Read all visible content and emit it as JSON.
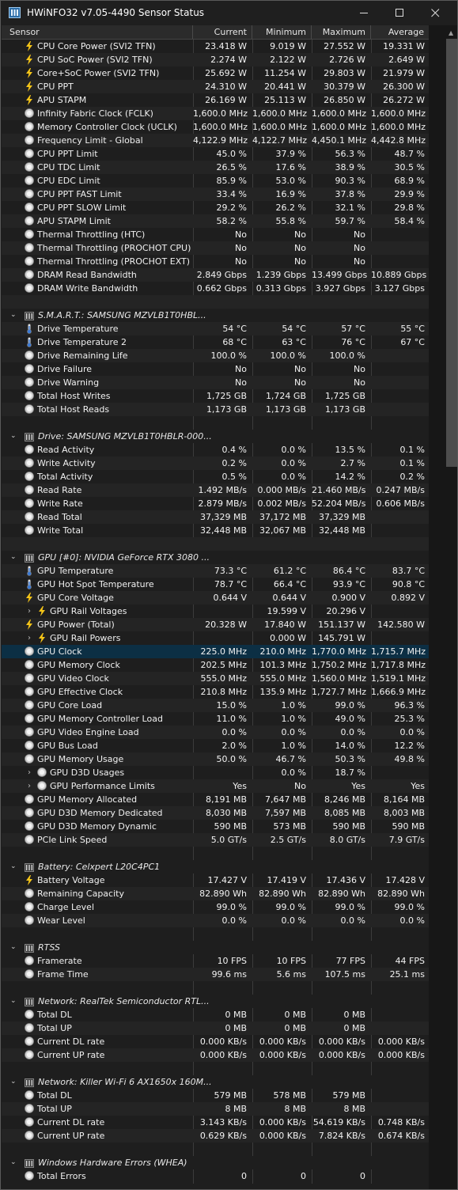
{
  "window": {
    "title": "HWiNFO32 v7.05-4490 Sensor Status"
  },
  "header": {
    "sensor": "Sensor",
    "current": "Current",
    "minimum": "Minimum",
    "maximum": "Maximum",
    "average": "Average"
  },
  "rows": [
    {
      "kind": "row",
      "icon": "bolt-icon",
      "label": "CPU Core Power (SVI2 TFN)",
      "cur": "23.418 W",
      "min": "9.019 W",
      "max": "27.552 W",
      "avg": "19.331 W"
    },
    {
      "kind": "row",
      "icon": "bolt-icon",
      "label": "CPU SoC Power (SVI2 TFN)",
      "cur": "2.274 W",
      "min": "2.122 W",
      "max": "2.726 W",
      "avg": "2.649 W"
    },
    {
      "kind": "row",
      "icon": "bolt-icon",
      "label": "Core+SoC Power (SVI2 TFN)",
      "cur": "25.692 W",
      "min": "11.254 W",
      "max": "29.803 W",
      "avg": "21.979 W"
    },
    {
      "kind": "row",
      "icon": "bolt-icon",
      "label": "CPU PPT",
      "cur": "24.310 W",
      "min": "20.441 W",
      "max": "30.379 W",
      "avg": "26.300 W"
    },
    {
      "kind": "row",
      "icon": "bolt-icon",
      "label": "APU STAPM",
      "cur": "26.169 W",
      "min": "25.113 W",
      "max": "26.850 W",
      "avg": "26.272 W"
    },
    {
      "kind": "row",
      "icon": "gauge-icon",
      "label": "Infinity Fabric Clock (FCLK)",
      "cur": "1,600.0 MHz",
      "min": "1,600.0 MHz",
      "max": "1,600.0 MHz",
      "avg": "1,600.0 MHz"
    },
    {
      "kind": "row",
      "icon": "gauge-icon",
      "label": "Memory Controller Clock (UCLK)",
      "cur": "1,600.0 MHz",
      "min": "1,600.0 MHz",
      "max": "1,600.0 MHz",
      "avg": "1,600.0 MHz"
    },
    {
      "kind": "row",
      "icon": "gauge-icon",
      "label": "Frequency Limit - Global",
      "cur": "4,122.9 MHz",
      "min": "4,122.7 MHz",
      "max": "4,450.1 MHz",
      "avg": "4,442.8 MHz"
    },
    {
      "kind": "row",
      "icon": "gauge-icon",
      "label": "CPU PPT Limit",
      "cur": "45.0 %",
      "min": "37.9 %",
      "max": "56.3 %",
      "avg": "48.7 %"
    },
    {
      "kind": "row",
      "icon": "gauge-icon",
      "label": "CPU TDC Limit",
      "cur": "26.5 %",
      "min": "17.6 %",
      "max": "38.9 %",
      "avg": "30.5 %"
    },
    {
      "kind": "row",
      "icon": "gauge-icon",
      "label": "CPU EDC Limit",
      "cur": "85.9 %",
      "min": "53.0 %",
      "max": "90.3 %",
      "avg": "68.9 %"
    },
    {
      "kind": "row",
      "icon": "gauge-icon",
      "label": "CPU PPT FAST Limit",
      "cur": "33.4 %",
      "min": "16.9 %",
      "max": "37.8 %",
      "avg": "29.9 %"
    },
    {
      "kind": "row",
      "icon": "gauge-icon",
      "label": "CPU PPT SLOW Limit",
      "cur": "29.2 %",
      "min": "26.2 %",
      "max": "32.1 %",
      "avg": "29.8 %"
    },
    {
      "kind": "row",
      "icon": "gauge-icon",
      "label": "APU STAPM Limit",
      "cur": "58.2 %",
      "min": "55.8 %",
      "max": "59.7 %",
      "avg": "58.4 %"
    },
    {
      "kind": "row",
      "icon": "gauge-icon",
      "label": "Thermal Throttling (HTC)",
      "cur": "No",
      "min": "No",
      "max": "No",
      "avg": ""
    },
    {
      "kind": "row",
      "icon": "gauge-icon",
      "label": "Thermal Throttling (PROCHOT CPU)",
      "cur": "No",
      "min": "No",
      "max": "No",
      "avg": ""
    },
    {
      "kind": "row",
      "icon": "gauge-icon",
      "label": "Thermal Throttling (PROCHOT EXT)",
      "cur": "No",
      "min": "No",
      "max": "No",
      "avg": ""
    },
    {
      "kind": "row",
      "icon": "gauge-icon",
      "label": "DRAM Read Bandwidth",
      "cur": "2.849 Gbps",
      "min": "1.239 Gbps",
      "max": "13.499 Gbps",
      "avg": "10.889 Gbps"
    },
    {
      "kind": "row",
      "icon": "gauge-icon",
      "label": "DRAM Write Bandwidth",
      "cur": "0.662 Gbps",
      "min": "0.313 Gbps",
      "max": "3.927 Gbps",
      "avg": "3.127 Gbps"
    },
    {
      "kind": "blank"
    },
    {
      "kind": "group",
      "label": "S.M.A.R.T.: SAMSUNG MZVLB1T0HBL..."
    },
    {
      "kind": "row",
      "icon": "thermometer-icon",
      "label": "Drive Temperature",
      "cur": "54 °C",
      "min": "54 °C",
      "max": "57 °C",
      "avg": "55 °C"
    },
    {
      "kind": "row",
      "icon": "thermometer-icon",
      "label": "Drive Temperature 2",
      "cur": "68 °C",
      "min": "63 °C",
      "max": "76 °C",
      "avg": "67 °C"
    },
    {
      "kind": "row",
      "icon": "gauge-icon",
      "label": "Drive Remaining Life",
      "cur": "100.0 %",
      "min": "100.0 %",
      "max": "100.0 %",
      "avg": ""
    },
    {
      "kind": "row",
      "icon": "gauge-icon",
      "label": "Drive Failure",
      "cur": "No",
      "min": "No",
      "max": "No",
      "avg": ""
    },
    {
      "kind": "row",
      "icon": "gauge-icon",
      "label": "Drive Warning",
      "cur": "No",
      "min": "No",
      "max": "No",
      "avg": ""
    },
    {
      "kind": "row",
      "icon": "gauge-icon",
      "label": "Total Host Writes",
      "cur": "1,725 GB",
      "min": "1,724 GB",
      "max": "1,725 GB",
      "avg": ""
    },
    {
      "kind": "row",
      "icon": "gauge-icon",
      "label": "Total Host Reads",
      "cur": "1,173 GB",
      "min": "1,173 GB",
      "max": "1,173 GB",
      "avg": ""
    },
    {
      "kind": "blank"
    },
    {
      "kind": "group",
      "label": "Drive: SAMSUNG MZVLB1T0HBLR-000..."
    },
    {
      "kind": "row",
      "icon": "gauge-icon",
      "label": "Read Activity",
      "cur": "0.4 %",
      "min": "0.0 %",
      "max": "13.5 %",
      "avg": "0.1 %"
    },
    {
      "kind": "row",
      "icon": "gauge-icon",
      "label": "Write Activity",
      "cur": "0.2 %",
      "min": "0.0 %",
      "max": "2.7 %",
      "avg": "0.1 %"
    },
    {
      "kind": "row",
      "icon": "gauge-icon",
      "label": "Total Activity",
      "cur": "0.5 %",
      "min": "0.0 %",
      "max": "14.2 %",
      "avg": "0.2 %"
    },
    {
      "kind": "row",
      "icon": "gauge-icon",
      "label": "Read Rate",
      "cur": "1.492 MB/s",
      "min": "0.000 MB/s",
      "max": "21.460 MB/s",
      "avg": "0.247 MB/s"
    },
    {
      "kind": "row",
      "icon": "gauge-icon",
      "label": "Write Rate",
      "cur": "2.879 MB/s",
      "min": "0.002 MB/s",
      "max": "52.204 MB/s",
      "avg": "0.606 MB/s"
    },
    {
      "kind": "row",
      "icon": "gauge-icon",
      "label": "Read Total",
      "cur": "37,329 MB",
      "min": "37,172 MB",
      "max": "37,329 MB",
      "avg": ""
    },
    {
      "kind": "row",
      "icon": "gauge-icon",
      "label": "Write Total",
      "cur": "32,448 MB",
      "min": "32,067 MB",
      "max": "32,448 MB",
      "avg": ""
    },
    {
      "kind": "blank"
    },
    {
      "kind": "group",
      "label": "GPU [#0]: NVIDIA GeForce RTX 3080 ..."
    },
    {
      "kind": "row",
      "icon": "thermometer-icon",
      "label": "GPU Temperature",
      "cur": "73.3 °C",
      "min": "61.2 °C",
      "max": "86.4 °C",
      "avg": "83.7 °C"
    },
    {
      "kind": "row",
      "icon": "thermometer-icon",
      "label": "GPU Hot Spot Temperature",
      "cur": "78.7 °C",
      "min": "66.4 °C",
      "max": "93.9 °C",
      "avg": "90.8 °C"
    },
    {
      "kind": "row",
      "icon": "bolt-icon",
      "label": "GPU Core Voltage",
      "cur": "0.644 V",
      "min": "0.644 V",
      "max": "0.900 V",
      "avg": "0.892 V"
    },
    {
      "kind": "sub",
      "icon": "bolt-icon",
      "label": "GPU Rail Voltages",
      "cur": "",
      "min": "19.599 V",
      "max": "20.296 V",
      "avg": ""
    },
    {
      "kind": "row",
      "icon": "bolt-icon",
      "label": "GPU Power (Total)",
      "cur": "20.328 W",
      "min": "17.840 W",
      "max": "151.137 W",
      "avg": "142.580 W"
    },
    {
      "kind": "sub",
      "icon": "bolt-icon",
      "label": "GPU Rail Powers",
      "cur": "",
      "min": "0.000 W",
      "max": "145.791 W",
      "avg": ""
    },
    {
      "kind": "row",
      "icon": "gauge-icon",
      "label": "GPU Clock",
      "cur": "225.0 MHz",
      "min": "210.0 MHz",
      "max": "1,770.0 MHz",
      "avg": "1,715.7 MHz",
      "selected": true
    },
    {
      "kind": "row",
      "icon": "gauge-icon",
      "label": "GPU Memory Clock",
      "cur": "202.5 MHz",
      "min": "101.3 MHz",
      "max": "1,750.2 MHz",
      "avg": "1,717.8 MHz"
    },
    {
      "kind": "row",
      "icon": "gauge-icon",
      "label": "GPU Video Clock",
      "cur": "555.0 MHz",
      "min": "555.0 MHz",
      "max": "1,560.0 MHz",
      "avg": "1,519.1 MHz"
    },
    {
      "kind": "row",
      "icon": "gauge-icon",
      "label": "GPU Effective Clock",
      "cur": "210.8 MHz",
      "min": "135.9 MHz",
      "max": "1,727.7 MHz",
      "avg": "1,666.9 MHz"
    },
    {
      "kind": "row",
      "icon": "gauge-icon",
      "label": "GPU Core Load",
      "cur": "15.0 %",
      "min": "1.0 %",
      "max": "99.0 %",
      "avg": "96.3 %"
    },
    {
      "kind": "row",
      "icon": "gauge-icon",
      "label": "GPU Memory Controller Load",
      "cur": "11.0 %",
      "min": "1.0 %",
      "max": "49.0 %",
      "avg": "25.3 %"
    },
    {
      "kind": "row",
      "icon": "gauge-icon",
      "label": "GPU Video Engine Load",
      "cur": "0.0 %",
      "min": "0.0 %",
      "max": "0.0 %",
      "avg": "0.0 %"
    },
    {
      "kind": "row",
      "icon": "gauge-icon",
      "label": "GPU Bus Load",
      "cur": "2.0 %",
      "min": "1.0 %",
      "max": "14.0 %",
      "avg": "12.2 %"
    },
    {
      "kind": "row",
      "icon": "gauge-icon",
      "label": "GPU Memory Usage",
      "cur": "50.0 %",
      "min": "46.7 %",
      "max": "50.3 %",
      "avg": "49.8 %"
    },
    {
      "kind": "sub",
      "icon": "gauge-icon",
      "label": "GPU D3D Usages",
      "cur": "",
      "min": "0.0 %",
      "max": "18.7 %",
      "avg": ""
    },
    {
      "kind": "sub",
      "icon": "gauge-icon",
      "label": "GPU Performance Limits",
      "cur": "Yes",
      "min": "No",
      "max": "Yes",
      "avg": "Yes"
    },
    {
      "kind": "row",
      "icon": "gauge-icon",
      "label": "GPU Memory Allocated",
      "cur": "8,191 MB",
      "min": "7,647 MB",
      "max": "8,246 MB",
      "avg": "8,164 MB"
    },
    {
      "kind": "row",
      "icon": "gauge-icon",
      "label": "GPU D3D Memory Dedicated",
      "cur": "8,030 MB",
      "min": "7,597 MB",
      "max": "8,085 MB",
      "avg": "8,003 MB"
    },
    {
      "kind": "row",
      "icon": "gauge-icon",
      "label": "GPU D3D Memory Dynamic",
      "cur": "590 MB",
      "min": "573 MB",
      "max": "590 MB",
      "avg": "590 MB"
    },
    {
      "kind": "row",
      "icon": "gauge-icon",
      "label": "PCIe Link Speed",
      "cur": "5.0 GT/s",
      "min": "2.5 GT/s",
      "max": "8.0 GT/s",
      "avg": "7.9 GT/s"
    },
    {
      "kind": "blank"
    },
    {
      "kind": "group",
      "label": "Battery: Celxpert L20C4PC1"
    },
    {
      "kind": "row",
      "icon": "bolt-icon",
      "label": "Battery Voltage",
      "cur": "17.427 V",
      "min": "17.419 V",
      "max": "17.436 V",
      "avg": "17.428 V"
    },
    {
      "kind": "row",
      "icon": "gauge-icon",
      "label": "Remaining Capacity",
      "cur": "82.890 Wh",
      "min": "82.890 Wh",
      "max": "82.890 Wh",
      "avg": "82.890 Wh"
    },
    {
      "kind": "row",
      "icon": "gauge-icon",
      "label": "Charge Level",
      "cur": "99.0 %",
      "min": "99.0 %",
      "max": "99.0 %",
      "avg": "99.0 %"
    },
    {
      "kind": "row",
      "icon": "gauge-icon",
      "label": "Wear Level",
      "cur": "0.0 %",
      "min": "0.0 %",
      "max": "0.0 %",
      "avg": "0.0 %"
    },
    {
      "kind": "blank"
    },
    {
      "kind": "group",
      "label": "RTSS"
    },
    {
      "kind": "row",
      "icon": "gauge-icon",
      "label": "Framerate",
      "cur": "10 FPS",
      "min": "10 FPS",
      "max": "77 FPS",
      "avg": "44 FPS"
    },
    {
      "kind": "row",
      "icon": "gauge-icon",
      "label": "Frame Time",
      "cur": "99.6 ms",
      "min": "5.6 ms",
      "max": "107.5 ms",
      "avg": "25.1 ms"
    },
    {
      "kind": "blank"
    },
    {
      "kind": "group",
      "label": "Network: RealTek Semiconductor RTL..."
    },
    {
      "kind": "row",
      "icon": "gauge-icon",
      "label": "Total DL",
      "cur": "0 MB",
      "min": "0 MB",
      "max": "0 MB",
      "avg": ""
    },
    {
      "kind": "row",
      "icon": "gauge-icon",
      "label": "Total UP",
      "cur": "0 MB",
      "min": "0 MB",
      "max": "0 MB",
      "avg": ""
    },
    {
      "kind": "row",
      "icon": "gauge-icon",
      "label": "Current DL rate",
      "cur": "0.000 KB/s",
      "min": "0.000 KB/s",
      "max": "0.000 KB/s",
      "avg": "0.000 KB/s"
    },
    {
      "kind": "row",
      "icon": "gauge-icon",
      "label": "Current UP rate",
      "cur": "0.000 KB/s",
      "min": "0.000 KB/s",
      "max": "0.000 KB/s",
      "avg": "0.000 KB/s"
    },
    {
      "kind": "blank"
    },
    {
      "kind": "group",
      "label": "Network: Killer Wi-Fi 6 AX1650x 160M..."
    },
    {
      "kind": "row",
      "icon": "gauge-icon",
      "label": "Total DL",
      "cur": "579 MB",
      "min": "578 MB",
      "max": "579 MB",
      "avg": ""
    },
    {
      "kind": "row",
      "icon": "gauge-icon",
      "label": "Total UP",
      "cur": "8 MB",
      "min": "8 MB",
      "max": "8 MB",
      "avg": ""
    },
    {
      "kind": "row",
      "icon": "gauge-icon",
      "label": "Current DL rate",
      "cur": "3.143 KB/s",
      "min": "0.000 KB/s",
      "max": "54.619 KB/s",
      "avg": "0.748 KB/s"
    },
    {
      "kind": "row",
      "icon": "gauge-icon",
      "label": "Current UP rate",
      "cur": "0.629 KB/s",
      "min": "0.000 KB/s",
      "max": "7.824 KB/s",
      "avg": "0.674 KB/s"
    },
    {
      "kind": "blank"
    },
    {
      "kind": "group",
      "label": "Windows Hardware Errors (WHEA)"
    },
    {
      "kind": "row",
      "icon": "gauge-icon",
      "label": "Total Errors",
      "cur": "0",
      "min": "0",
      "max": "0",
      "avg": ""
    }
  ]
}
